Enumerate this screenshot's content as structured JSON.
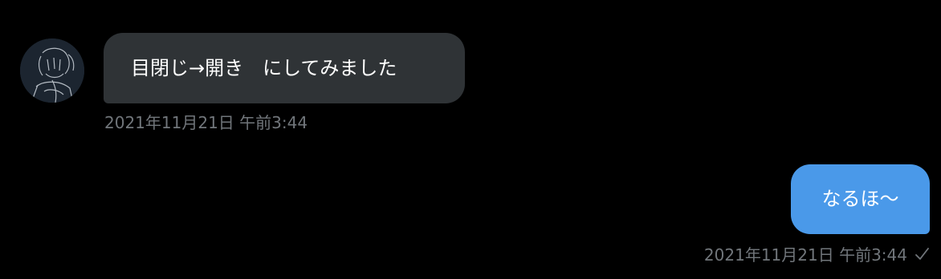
{
  "conversation": {
    "incoming": {
      "text": "目閉じ→開き　にしてみました",
      "timestamp": "2021年11月21日 午前3:44",
      "avatar_icon": "user-avatar-illustration"
    },
    "outgoing": {
      "text": "なるほ〜",
      "timestamp": "2021年11月21日 午前3:44",
      "status_icon": "checkmark-icon"
    }
  },
  "colors": {
    "background": "#000000",
    "incoming_bubble": "#2f3336",
    "outgoing_bubble": "#4a99e9",
    "timestamp": "#71767b",
    "text": "#ffffff"
  }
}
